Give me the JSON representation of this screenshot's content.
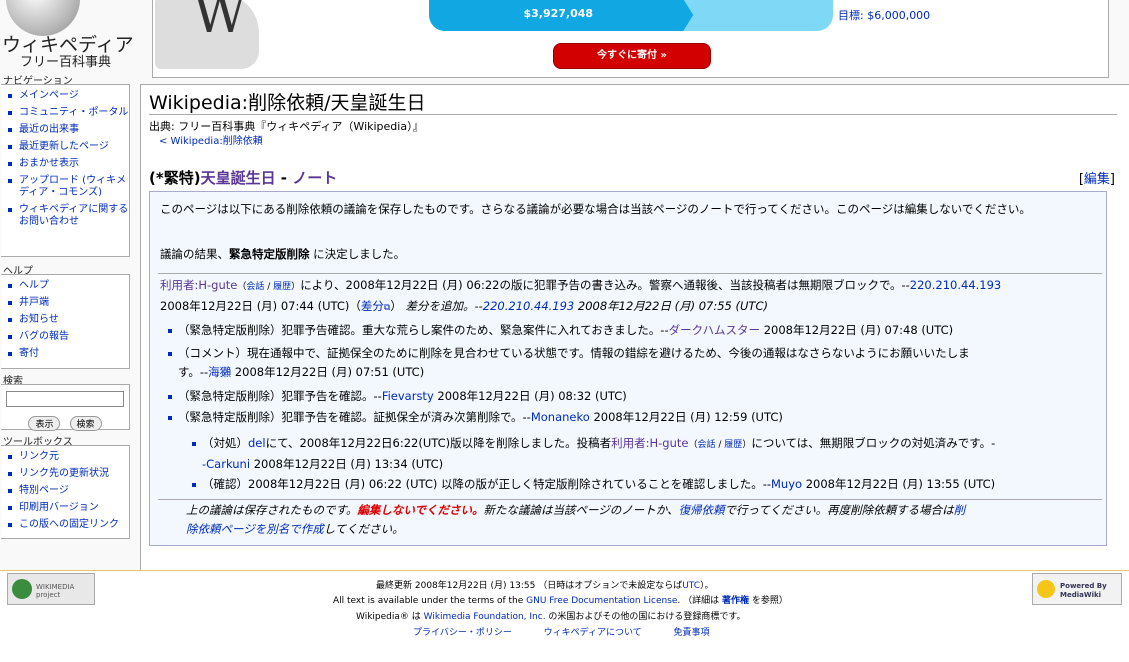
{
  "logo": {
    "title": "ウィキペディア",
    "tagline": "フリー百科事典"
  },
  "nav": {
    "heading": "ナビゲーション",
    "items": [
      "メインページ",
      "コミュニティ・ポータル",
      "最近の出来事",
      "最近更新したページ",
      "おまかせ表示",
      "アップロード (ウィキメディア・コモンズ)",
      "ウィキペディアに関するお問い合わせ"
    ]
  },
  "help": {
    "heading": "ヘルプ",
    "items": [
      "ヘルプ",
      "井戸端",
      "お知らせ",
      "バグの報告",
      "寄付"
    ]
  },
  "search": {
    "heading": "検索",
    "value": "",
    "go_label": "表示",
    "search_label": "検索"
  },
  "toolbox": {
    "heading": "ツールボックス",
    "items": [
      "リンク元",
      "リンク先の更新状況",
      "特別ページ",
      "印刷用バージョン",
      "この版への固定リンク"
    ]
  },
  "fundraiser": {
    "raised": "$3,927,048",
    "goal": "目標: $6,000,000",
    "progress": 0.654,
    "donate_label": "今すぐに寄付 »",
    "bar_color": "#11a7e2",
    "button_color": "#d20000"
  },
  "page": {
    "title": "Wikipedia:削除依頼/天皇誕生日",
    "from": "出典: フリー百科事典『ウィキペディア（Wikipedia）』",
    "subpage": "< Wikipedia:削除依頼",
    "heading_prefix": "(*緊特)",
    "heading_link": "天皇誕生日",
    "heading_sep": " - ",
    "heading_talk": "ノート",
    "edit": "編集"
  },
  "archive": {
    "notice": "このページは以下にある削除依頼の議論を保存したものです。さらなる議論が必要な場合は当該ページのノートで行ってください。このページは編集しないでください。",
    "result_pre": "議論の結果、",
    "result_bold": "緊急特定版削除",
    "result_post": " に決定しました。",
    "nom_user": "利用者:H-gute",
    "nom_talk": "会話",
    "nom_hist": "履歴",
    "nom_text1": "により、2008年12月22日 (月) 06:22の版に犯罪予告の書き込み。警察へ通報後、当該投稿者は無期限ブロックで。--",
    "nom_ip": "220.210.44.193",
    "nom_text2": "2008年12月22日 (月) 07:44 (UTC)",
    "nom_diff": "差分",
    "nom_text3": "差分を追加。--",
    "nom_ip2": "220.210.44.193",
    "nom_text4": "2008年12月22日 (月) 07:55 (UTC)",
    "c1_text": "（緊急特定版削除）犯罪予告確認。重大な荒らし案件のため、緊急案件に入れておきました。--",
    "c1_user": "ダークハムスター",
    "c1_time": " 2008年12月22日 (月) 07:48 (UTC)",
    "c2_text": "（コメント）現在通報中で、証拠保全のために削除を見合わせている状態です。情報の錯綜を避けるため、今後の通報はなさらないようにお願いいたしま",
    "c2_text2": "す。--",
    "c2_user": "海獺",
    "c2_time": " 2008年12月22日 (月) 07:51 (UTC)",
    "c3_text": "（緊急特定版削除）犯罪予告を確認。--",
    "c3_user": "Fievarsty",
    "c3_time": " 2008年12月22日 (月) 08:32 (UTC)",
    "c4_text": "（緊急特定版削除）犯罪予告を確認。証拠保全が済み次第削除で。--",
    "c4_user": "Monaneko",
    "c4_time": " 2008年12月22日 (月) 12:59 (UTC)",
    "c5_pre": "（対処）",
    "c5_del": "del",
    "c5_text": "にて、2008年12月22日6:22(UTC)版以降を削除しました。投稿者",
    "c5_user": "利用者:H-gute",
    "c5_talk": "会話",
    "c5_hist": "履歴",
    "c5_text2": "については、無期限ブロックの対処済みです。-",
    "c5_user2": "-Carkuni",
    "c5_time": " 2008年12月22日 (月) 13:34 (UTC)",
    "c6_text": "（確認）2008年12月22日 (月) 06:22 (UTC) 以降の版が正しく特定版削除されていることを確認しました。--",
    "c6_user": "Muyo",
    "c6_time": " 2008年12月22日 (月) 13:55 (UTC)",
    "end_pre": "上の議論は保存されたものです。",
    "end_red": "編集しないでください。",
    "end_mid": "新たな議論は当該ページのノートか、",
    "end_link": "復帰依頼",
    "end_mid2": "で行ってください。再度削除依頼する場合は",
    "end_link2": "削",
    "end_link3": "除依頼ページを別名で作成",
    "end_post": "してください。"
  },
  "footer": {
    "wikimedia_logo": "WIKIMEDIA project",
    "mediawiki_logo": "Powered By MediaWiki",
    "lastmod": "最終更新 2008年12月22日 (月) 13:55 （日時はオプションで未設定ならば",
    "lastmod_utc": "UTC",
    "lastmod_end": "）。",
    "license_pre": "All text is available under the terms of the ",
    "license_link": "GNU Free Documentation License",
    "license_post": ". （詳細は ",
    "copyright_link": "著作権",
    "license_end": " を参照）",
    "tm_pre": "Wikipedia® は ",
    "tm_link": "Wikimedia Foundation, Inc.",
    "tm_post": " の米国およびその他の国における登録商標です。",
    "links": [
      "プライバシー・ポリシー",
      "ウィキペディアについて",
      "免責事項"
    ]
  }
}
